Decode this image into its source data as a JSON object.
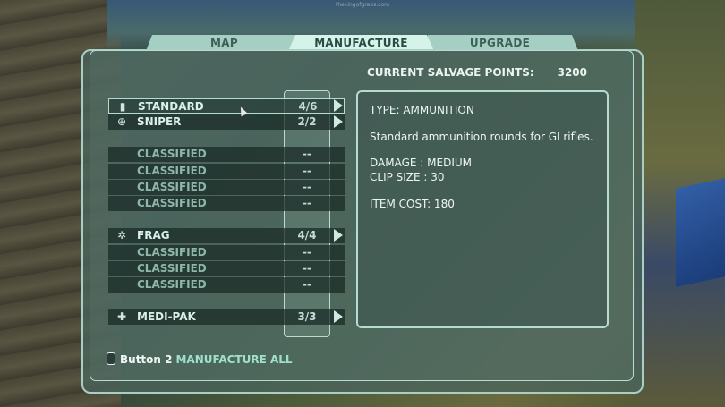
{
  "watermark": "thekingofgrabs.com",
  "tabs": [
    {
      "label": "MAP"
    },
    {
      "label": "MANUFACTURE"
    },
    {
      "label": "UPGRADE"
    }
  ],
  "salvage": {
    "label": "CURRENT SALVAGE POINTS:",
    "value": "3200"
  },
  "items": [
    {
      "label": "STANDARD",
      "count": "4/6",
      "icon": "bullet-icon"
    },
    {
      "label": "SNIPER",
      "count": "2/2",
      "icon": "crosshair-icon"
    },
    {
      "label": "CLASSIFIED",
      "count": "--"
    },
    {
      "label": "CLASSIFIED",
      "count": "--"
    },
    {
      "label": "CLASSIFIED",
      "count": "--"
    },
    {
      "label": "CLASSIFIED",
      "count": "--"
    },
    {
      "label": "FRAG",
      "count": "4/4",
      "icon": "gear-icon"
    },
    {
      "label": "CLASSIFIED",
      "count": "--"
    },
    {
      "label": "CLASSIFIED",
      "count": "--"
    },
    {
      "label": "CLASSIFIED",
      "count": "--"
    },
    {
      "label": "MEDI-PAK",
      "count": "3/3",
      "icon": "cross-icon"
    }
  ],
  "info": {
    "type": "TYPE: AMMUNITION",
    "description": "Standard ammunition rounds for GI rifles.",
    "damage": "DAMAGE : MEDIUM",
    "clip": "CLIP SIZE : 30",
    "cost": "ITEM COST: 180"
  },
  "footer": {
    "button": "Button 2",
    "action": "MANUFACTURE ALL"
  },
  "colors": {
    "accent": "#b6dbd1",
    "action_text": "#9fe0cc"
  }
}
